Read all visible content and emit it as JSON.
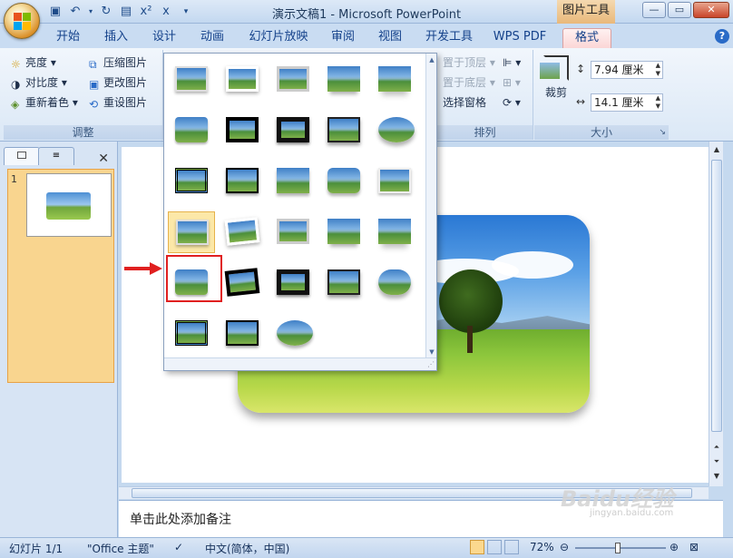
{
  "title": "演示文稿1 - Microsoft PowerPoint",
  "context_tab": "图片工具",
  "quick_access": [
    "save",
    "undo",
    "redo",
    "preview",
    "x2",
    "x"
  ],
  "window_buttons": [
    "minimize",
    "restore",
    "close"
  ],
  "tabs": [
    "开始",
    "插入",
    "设计",
    "动画",
    "幻灯片放映",
    "审阅",
    "视图",
    "开发工具",
    "WPS PDF",
    "格式"
  ],
  "ribbon": {
    "adjust": {
      "label": "调整",
      "brightness": "亮度",
      "contrast": "对比度",
      "recolor": "重新着色",
      "compress": "压缩图片",
      "change": "更改图片",
      "reset": "重设图片"
    },
    "arrange": {
      "label": "排列",
      "bring_front": "置于顶层",
      "send_back": "置于底层",
      "selection_pane": "选择窗格"
    },
    "size": {
      "label": "大小",
      "crop": "裁剪",
      "height": "7.94 厘米",
      "width": "14.1 厘米"
    }
  },
  "left_panel": {
    "slide_number": "1"
  },
  "notes_placeholder": "单击此处添加备注",
  "status": {
    "slide": "幻灯片 1/1",
    "theme": "\"Office 主题\"",
    "language": "中文(简体，中国)",
    "zoom": "72%"
  },
  "watermark": "Baidu经验",
  "watermark_sub": "jingyan.baidu.com",
  "colors": {
    "accent": "#15428b",
    "selection": "#fce8a8",
    "highlight_red": "#e02020"
  },
  "gallery": {
    "selected_index": 15,
    "item_count": 28
  }
}
